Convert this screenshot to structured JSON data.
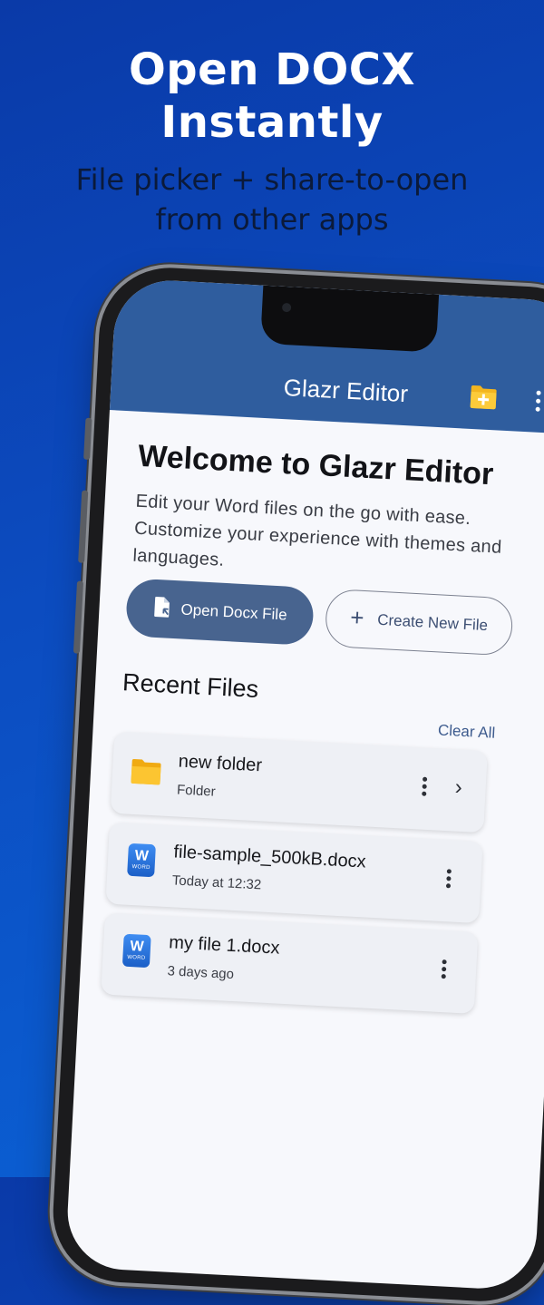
{
  "hero": {
    "title_line1": "Open DOCX",
    "title_line2": "Instantly",
    "subtitle_line1": "File picker + share-to-open",
    "subtitle_line2": "from other apps"
  },
  "appbar": {
    "title": "Glazr Editor",
    "folder_icon": "folder-plus-icon",
    "menu_icon": "more-vertical-icon"
  },
  "welcome": {
    "heading": "Welcome to Glazr Editor",
    "body": "Edit your Word files on the go with ease. Customize your experience with themes and languages."
  },
  "actions": {
    "open_label": "Open Docx File",
    "new_label": "Create New File"
  },
  "recent": {
    "title": "Recent Files",
    "clear_label": "Clear All",
    "items": [
      {
        "name": "new folder",
        "sub": "Folder",
        "icon": "folder-icon"
      },
      {
        "name": "file-sample_500kB.docx",
        "sub": "Today at 12:32",
        "icon": "word-doc-icon"
      },
      {
        "name": "my file 1.docx",
        "sub": "3 days ago",
        "icon": "word-doc-icon"
      }
    ]
  },
  "word_icon": {
    "letter": "W",
    "caption": "WORD"
  },
  "colors": {
    "background": "#0c4cc0",
    "appbar": "#2f5d9e",
    "primary_button": "#48648f",
    "accent_text": "#3d5b8e"
  }
}
